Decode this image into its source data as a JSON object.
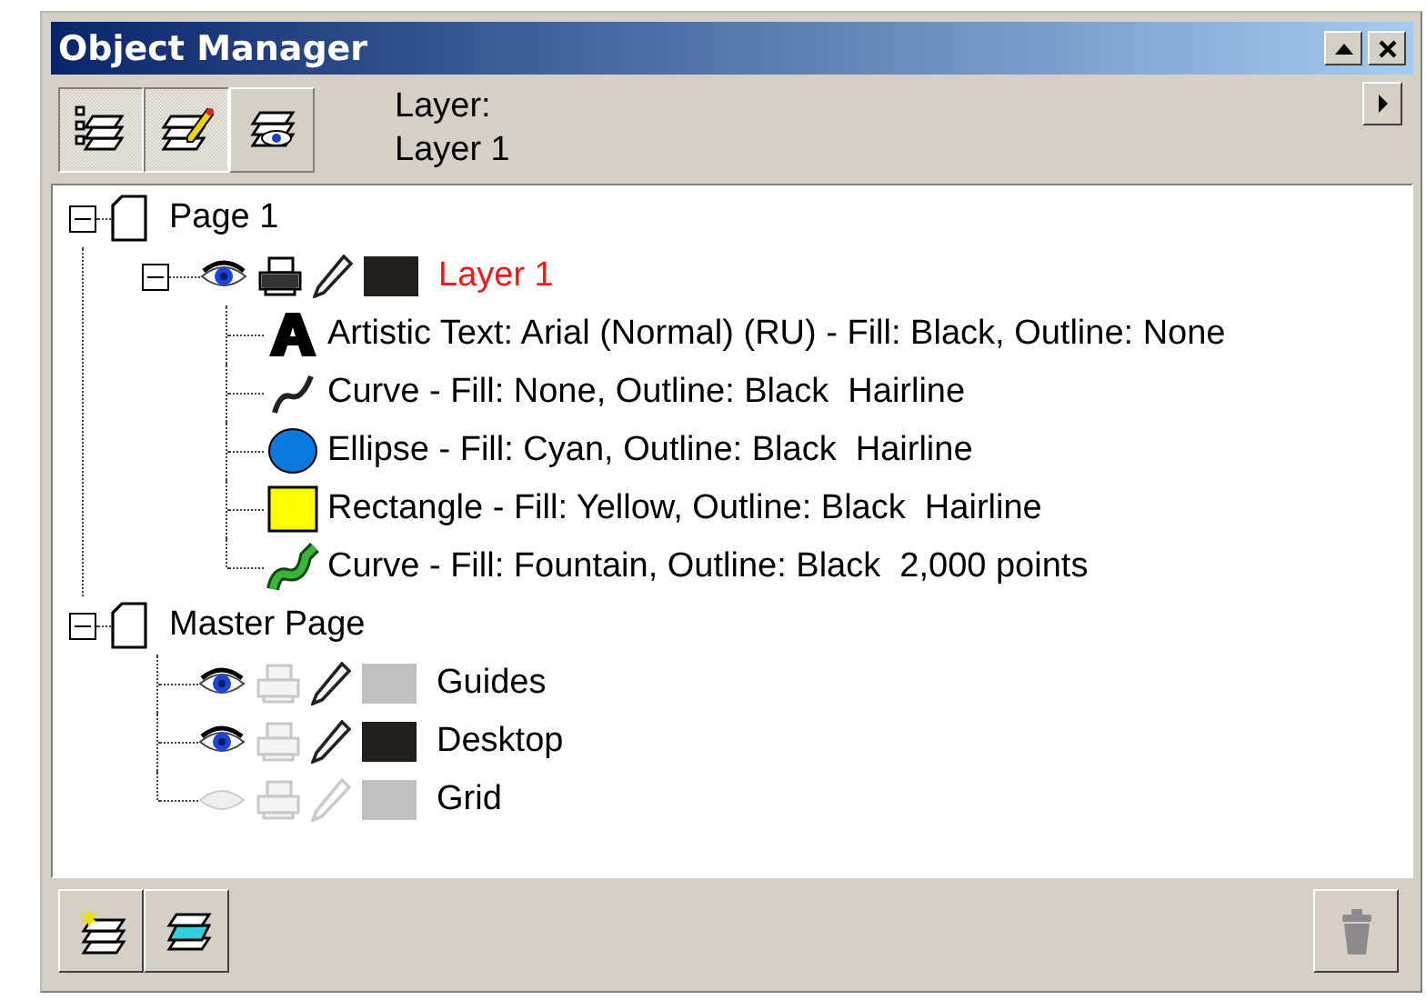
{
  "window": {
    "title": "Object Manager"
  },
  "toolbar": {
    "view_buttons": [
      {
        "kind": "properties",
        "selected": true
      },
      {
        "kind": "edit_layers",
        "selected": true
      },
      {
        "kind": "layer_view",
        "selected": false
      }
    ],
    "layer_caption": "Layer:",
    "current_layer": "Layer 1"
  },
  "tree": [
    {
      "label": "Page 1",
      "expanded": true,
      "children": [
        {
          "label": "Layer 1",
          "active": true,
          "expanded": true,
          "visible": true,
          "printable": true,
          "editable": true,
          "color": "#231f1c",
          "children": [
            {
              "kind": "text",
              "label": "Artistic Text: Arial (Normal) (RU) - Fill: Black, Outline: None"
            },
            {
              "kind": "curve",
              "label": "Curve - Fill: None, Outline: Black  Hairline"
            },
            {
              "kind": "ellipse",
              "label": "Ellipse - Fill: Cyan, Outline: Black  Hairline"
            },
            {
              "kind": "rectangle",
              "label": "Rectangle - Fill: Yellow, Outline: Black  Hairline"
            },
            {
              "kind": "fountain_curve",
              "label": "Curve - Fill: Fountain, Outline: Black  2,000 points"
            }
          ]
        }
      ]
    },
    {
      "label": "Master Page",
      "expanded": true,
      "children": [
        {
          "label": "Guides",
          "active": false,
          "visible": true,
          "printable": false,
          "editable": true,
          "color": "#c0c0c0"
        },
        {
          "label": "Desktop",
          "active": false,
          "visible": true,
          "printable": false,
          "editable": true,
          "color": "#231f1c"
        },
        {
          "label": "Grid",
          "active": false,
          "visible": false,
          "printable": false,
          "editable": false,
          "color": "#c0c0c0"
        }
      ]
    }
  ],
  "bottom_toolbar": {
    "delete_enabled": false
  }
}
